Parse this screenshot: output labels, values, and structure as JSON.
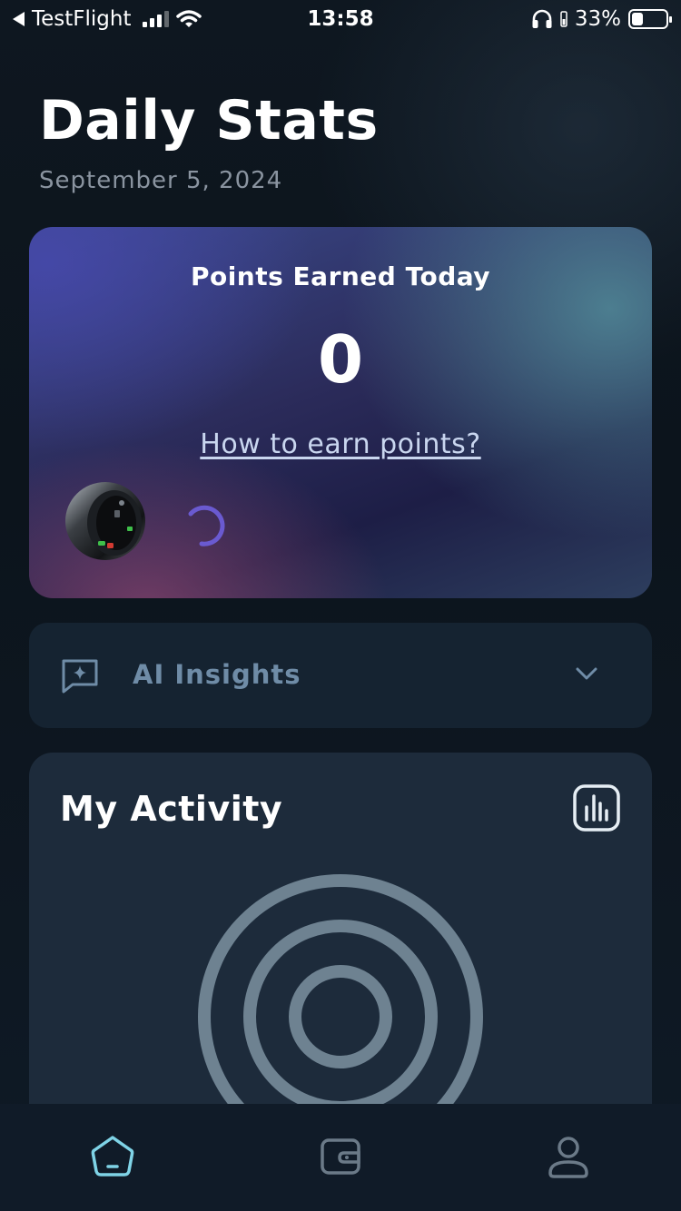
{
  "status_bar": {
    "back_app": "TestFlight",
    "time": "13:58",
    "battery_percent": "33%",
    "battery_level": 0.33
  },
  "header": {
    "title": "Daily Stats",
    "date": "September 5, 2024"
  },
  "points_card": {
    "label": "Points Earned Today",
    "value": "0",
    "link": "How to earn points?",
    "device_icon": "smart-ring-image",
    "loading_icon": "loading-spinner-icon"
  },
  "ai_insights": {
    "label": "AI Insights",
    "icon": "sparkle-chat-icon",
    "expand_icon": "chevron-down-icon"
  },
  "activity": {
    "title": "My Activity",
    "chart_icon": "bar-chart-icon"
  },
  "tab_bar": {
    "items": [
      {
        "name": "home",
        "icon": "home-icon",
        "active": true
      },
      {
        "name": "wallet",
        "icon": "wallet-icon",
        "active": false
      },
      {
        "name": "profile",
        "icon": "profile-icon",
        "active": false
      }
    ]
  },
  "colors": {
    "accent": "#7fd3e6",
    "muted_text": "#8a94a0",
    "ai_text": "#6f8ca7",
    "ring_gray": "#6e8291",
    "spinner": "#6a5ad0",
    "tab_inactive": "#6b7a88"
  }
}
